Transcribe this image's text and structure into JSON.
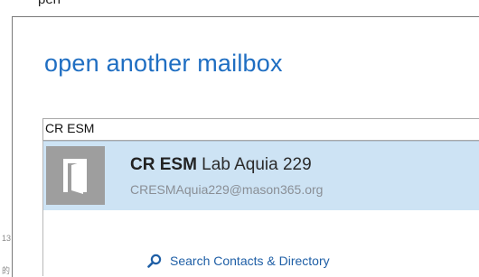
{
  "dialog": {
    "peek_text": "pen",
    "title": "open another mailbox",
    "search_value": "CR ESM"
  },
  "suggestion": {
    "name_bold": "CR ESM",
    "name_rest": " Lab Aquia 229",
    "email": "CRESMAquia229@mason365.org",
    "avatar_icon": "door-icon"
  },
  "directory_search": {
    "label": "Search Contacts & Directory",
    "icon": "search-icon"
  },
  "left_marks": [
    "13",
    "的"
  ],
  "colors": {
    "title_blue": "#1f6ec2",
    "selection_bg": "#cde3f4",
    "avatar_gray": "#9e9e9e",
    "link_blue": "#1f5fa6"
  }
}
